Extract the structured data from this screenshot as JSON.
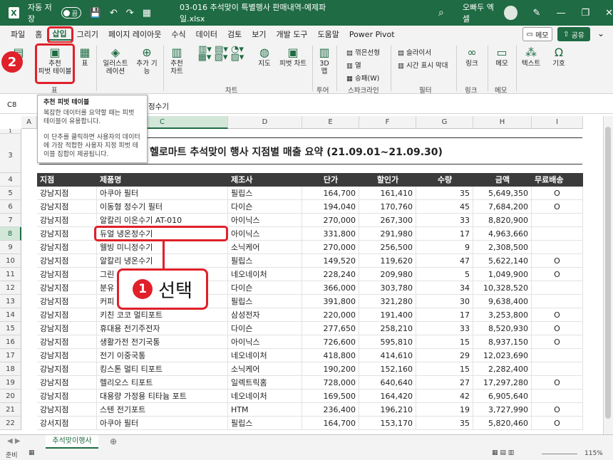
{
  "titlebar": {
    "autosave": "자동 저장",
    "toggle": "끔",
    "doc_title": "03-016 추석맞이 특별행사 판매내역-예제파일.xlsx",
    "user": "오빠두 엑셀"
  },
  "menu": [
    "파일",
    "홈",
    "삽입",
    "그리기",
    "페이지 레이아웃",
    "수식",
    "데이터",
    "검토",
    "보기",
    "개발 도구",
    "도움말",
    "Power Pivot"
  ],
  "memo_label": "메모",
  "share_label": "공유",
  "ribbon": {
    "recommended_pivot": "추천\n피벗 테이블",
    "table": "표",
    "illustrations": "일러스트\n레이션",
    "addins": "추가 기\n능",
    "recommended_charts": "추천\n차트",
    "map": "지도",
    "pivot_chart": "피벗 차트",
    "three_d": "3D\n맵",
    "line": "꺾은선형",
    "column": "열",
    "winloss": "승패(W)",
    "slicer": "슬라이서",
    "timeline": "시간 표시 막대",
    "link": "링크",
    "comment": "메모",
    "text": "텍스트",
    "symbol": "기호",
    "groups": {
      "table": "표",
      "charts": "차트",
      "tour": "투어",
      "sparkline": "스파크라인",
      "filter": "필터",
      "links": "링크",
      "comments": "메모"
    }
  },
  "tooltip": {
    "title": "추천 피벗 테이블",
    "p1": "복잡한 데이터를 요약할 때는 피벗 테이블이 유용합니다.",
    "p2": "이 단추를 클릭하면 사용자의 데이터에 가장 적합한 사용자 지정 피벗 테이블 집합이 제공됩니다."
  },
  "formula": {
    "cell": "C8",
    "value": "정수기"
  },
  "columns": [
    "A",
    "B",
    "C",
    "D",
    "E",
    "F",
    "G",
    "H",
    "I"
  ],
  "rows": [
    "1",
    "2",
    "3",
    "4",
    "5",
    "6",
    "7",
    "8",
    "9",
    "10",
    "11",
    "12",
    "13",
    "14",
    "15",
    "16",
    "17",
    "18",
    "19",
    "20",
    "21",
    "22"
  ],
  "sheet_title": "헬로마트 추석맞이 행사 지점별 매출 요약 (21.09.01~21.09.30)",
  "table_headers": [
    "지점",
    "제품명",
    "제조사",
    "단가",
    "할인가",
    "수량",
    "금액",
    "무료배송"
  ],
  "table_rows": [
    [
      "강남지점",
      "아쿠아 필터",
      "필립스",
      "164,700",
      "161,410",
      "35",
      "5,649,350",
      "O"
    ],
    [
      "강남지점",
      "이동형 정수기 필터",
      "다이슨",
      "194,040",
      "170,760",
      "45",
      "7,684,200",
      "O"
    ],
    [
      "강남지점",
      "알칼리 이온수기 AT-010",
      "아이닉스",
      "270,000",
      "267,300",
      "33",
      "8,820,900",
      ""
    ],
    [
      "강남지점",
      "듀얼 냉온정수기",
      "아이닉스",
      "331,800",
      "291,980",
      "17",
      "4,963,660",
      ""
    ],
    [
      "강남지점",
      "웰빙 미니정수기",
      "소닉케어",
      "270,000",
      "256,500",
      "9",
      "2,308,500",
      ""
    ],
    [
      "강남지점",
      "알칼리 냉온수기",
      "필립스",
      "149,520",
      "119,620",
      "47",
      "5,622,140",
      "O"
    ],
    [
      "강남지점",
      "그린",
      "네오네이처",
      "228,240",
      "209,980",
      "5",
      "1,049,900",
      "O"
    ],
    [
      "강남지점",
      "분유",
      "다이슨",
      "366,000",
      "303,780",
      "34",
      "10,328,520",
      ""
    ],
    [
      "강남지점",
      "커피",
      "필립스",
      "391,800",
      "321,280",
      "30",
      "9,638,400",
      ""
    ],
    [
      "강남지점",
      "키친 코코 멀티포트",
      "삼성전자",
      "220,000",
      "191,400",
      "17",
      "3,253,800",
      "O"
    ],
    [
      "강남지점",
      "휴대용 전기주전자",
      "다이슨",
      "277,650",
      "258,210",
      "33",
      "8,520,930",
      "O"
    ],
    [
      "강남지점",
      "생활가전 전기국통",
      "아이닉스",
      "726,600",
      "595,810",
      "15",
      "8,937,150",
      "O"
    ],
    [
      "강남지점",
      "전기 이중국통",
      "네오네이처",
      "418,800",
      "414,610",
      "29",
      "12,023,690",
      ""
    ],
    [
      "강남지점",
      "킹스톤 멀티 티포트",
      "소닉케어",
      "190,200",
      "152,160",
      "15",
      "2,282,400",
      ""
    ],
    [
      "강남지점",
      "헬리오스 티포트",
      "일렉트릭홈",
      "728,000",
      "640,640",
      "27",
      "17,297,280",
      "O"
    ],
    [
      "강남지점",
      "대용량 가정용 티타늄 포트",
      "네오네이처",
      "169,500",
      "164,420",
      "42",
      "6,905,640",
      ""
    ],
    [
      "강남지점",
      "스텐 전기포트",
      "HTM",
      "236,400",
      "196,210",
      "19",
      "3,727,990",
      "O"
    ],
    [
      "강서지점",
      "아쿠아 필터",
      "필립스",
      "164,700",
      "153,170",
      "35",
      "5,820,460",
      "O"
    ]
  ],
  "callouts": {
    "one": "1",
    "one_text": "선택",
    "two": "2"
  },
  "sheet_tab": "추석맞이행사",
  "status": {
    "ready": "준비",
    "zoom": "115%"
  }
}
